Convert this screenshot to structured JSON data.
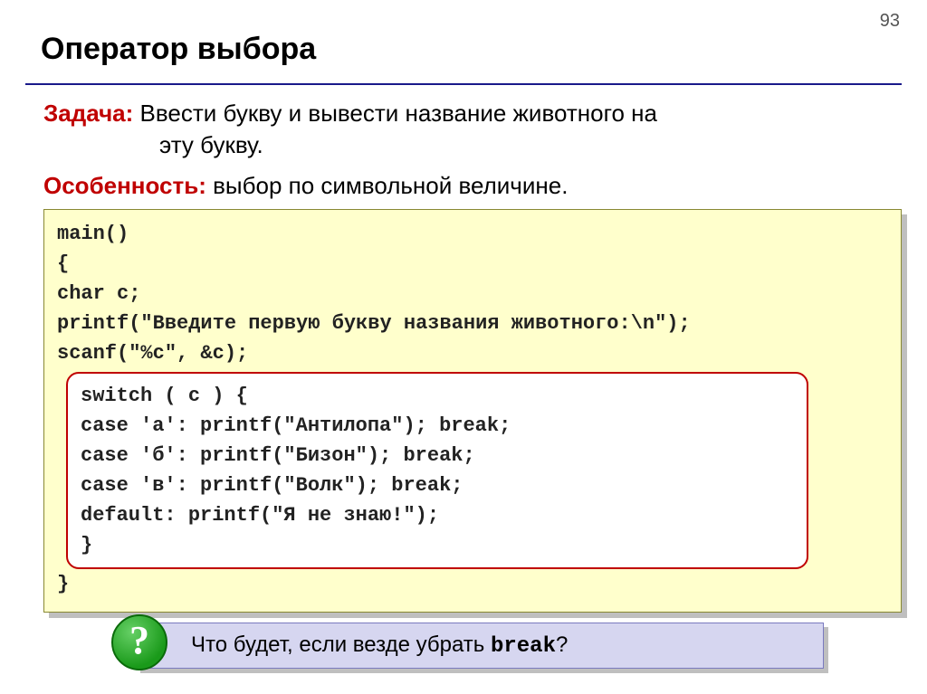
{
  "page_number": "93",
  "title": "Оператор выбора",
  "task": {
    "label": "Задача:",
    "text_line1": "Ввести букву и вывести название животного на",
    "text_line2": "эту букву."
  },
  "feature": {
    "label": "Особенность:",
    "text": "выбор по символьной величине."
  },
  "code": {
    "l1": "main()",
    "l2": "{",
    "l3": " char c;",
    "l4": " printf(\"Введите первую букву названия животного:\\n\");",
    "l5": " scanf(\"%c\", &c);",
    "s1": "switch ( c ) {",
    "s2": "  case 'а': printf(\"Антилопа\"); break;",
    "s3": "  case 'б': printf(\"Бизон\"); break;",
    "s4": "  case 'в': printf(\"Волк\"); break;",
    "s5": "  default:  printf(\"Я не знаю!\");",
    "s6": "  }",
    "l6": "}"
  },
  "hint": {
    "q": "?",
    "pre": "Что будет, если везде убрать ",
    "kw": "break",
    "post": "?"
  }
}
